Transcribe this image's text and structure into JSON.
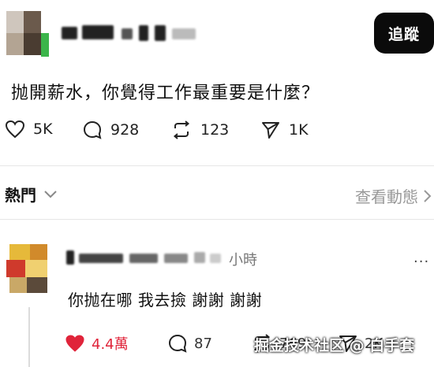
{
  "post": {
    "follow_label": "追蹤",
    "text": "抛開薪水，你覺得工作最重要是什麼？",
    "likes": "5K",
    "comments": "928",
    "reposts": "123",
    "shares": "1K"
  },
  "replies_section": {
    "title": "熱門",
    "view_activity": "查看動態"
  },
  "reply": {
    "time": "小時",
    "text": "你抛在哪 我去撿 謝謝  謝謝",
    "more": "···",
    "likes": "4.4萬",
    "comments": "87",
    "reposts": "769",
    "shares": "2K",
    "like_color": "#e0243a"
  },
  "watermark": "掘金技术社区 @ 白手套"
}
